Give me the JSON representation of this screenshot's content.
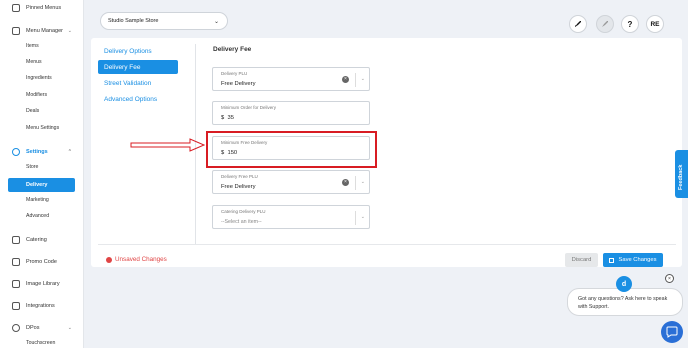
{
  "sidebar": {
    "pinned": "Pinned Menus",
    "menu_manager": "Menu Manager",
    "menu_manager_items": [
      "Items",
      "Menus",
      "Ingredients",
      "Modifiers",
      "Deals",
      "Menu Settings"
    ],
    "settings": "Settings",
    "settings_items": [
      "Store",
      "Delivery",
      "Marketing",
      "Advanced"
    ],
    "catering": "Catering",
    "promo_code": "Promo Code",
    "image_library": "Image Library",
    "integrations": "Integrations",
    "dpos": "DPos",
    "dpos_items": [
      "Touchscreen"
    ]
  },
  "header": {
    "store_select": "Studio Sample Store",
    "user_initials": "RE",
    "help_icon": "?"
  },
  "subnav": {
    "items": [
      "Delivery Options",
      "Delivery Fee",
      "Street Validation",
      "Advanced Options"
    ],
    "active": "Delivery Fee"
  },
  "main": {
    "title": "Delivery Fee",
    "fields": [
      {
        "label": "Delivery PLU",
        "value": "Free Delivery"
      },
      {
        "label": "Minimum Order for Delivery",
        "currency": "$",
        "value": "35"
      },
      {
        "label": "Minimum Free Delivery",
        "currency": "$",
        "value": "150"
      },
      {
        "label": "Delivery Free PLU",
        "value": "Free Delivery"
      },
      {
        "label": "Catering Delivery PLU",
        "placeholder": "--Select an item--"
      }
    ]
  },
  "footer": {
    "unsaved": "Unsaved Changes",
    "discard": "Discard",
    "save": "Save Changes"
  },
  "feedback": "Feedback",
  "chat": {
    "avatar": "d",
    "message": "Got any questions? Ask here to speak with Support.",
    "close": "×"
  },
  "colors": {
    "accent": "#1a8fe3",
    "highlight": "#d81c23",
    "unsaved": "#e04545"
  }
}
